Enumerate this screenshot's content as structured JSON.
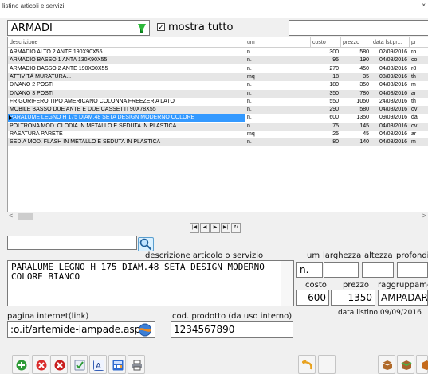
{
  "window": {
    "title": "listino articoli e servizi",
    "close_glyph": "×"
  },
  "filter": {
    "category": "ARMADI",
    "show_all_checked": true,
    "show_all_label": "mostra tutto",
    "search_value": ""
  },
  "grid": {
    "columns": [
      "descrizione",
      "um",
      "costo",
      "prezzo",
      "data lst.pr...",
      "pr"
    ],
    "rows": [
      [
        "ARMADIO ALTO 2 ANTE 190X90X55",
        "n.",
        "300",
        "580",
        "02/09/2016",
        "ro"
      ],
      [
        "ARMADIO BASSO 1 ANTA 130X90X55",
        "n.",
        "95",
        "190",
        "04/08/2016",
        "co"
      ],
      [
        "ARMADIO BASSO 2 ANTE 190X90X55",
        "n.",
        "270",
        "450",
        "04/08/2016",
        "r8"
      ],
      [
        "ATTIVITÀ MURATURA...",
        "mq",
        "18",
        "35",
        "08/09/2016",
        "th"
      ],
      [
        "DIVANO 2 POSTI",
        "n.",
        "180",
        "350",
        "04/08/2016",
        "m"
      ],
      [
        "DIVANO 3 POSTI",
        "n.",
        "350",
        "780",
        "04/08/2016",
        "ar"
      ],
      [
        "FRIGORIFERO TIPO AMERICANO COLONNA FREEZER A LATO",
        "n.",
        "550",
        "1050",
        "24/08/2016",
        "th"
      ],
      [
        "MOBILE BASSO DUE ANTE E DUE CASSETTI 90X78X55",
        "n.",
        "290",
        "580",
        "04/08/2016",
        "ov"
      ],
      [
        "PARALUME LEGNO H 175 DIAM.48 SETA DESIGN MODERNO COLORE",
        "n.",
        "600",
        "1350",
        "09/09/2016",
        "da"
      ],
      [
        "POLTRONA MOD. CLODIA IN METALLO E SEDUTA IN PLASTICA",
        "n.",
        "75",
        "145",
        "04/08/2016",
        "ov"
      ],
      [
        "RASATURA PARETE",
        "mq",
        "25",
        "45",
        "04/08/2016",
        "ar"
      ],
      [
        "SEDIA MOD. FLASH IN METALLO E SEDUTA IN PLASTICA",
        "n.",
        "80",
        "140",
        "04/08/2016",
        "m"
      ]
    ],
    "selected_index": 8
  },
  "navigator": [
    "|◀",
    "◀",
    "▶",
    "▶|",
    "↻"
  ],
  "scroll": {
    "left_glyph": "<",
    "right_glyph": ">"
  },
  "detail": {
    "desc_label": "descrizione articolo o servizio",
    "desc_value": "PARALUME LEGNO H 175 DIAM.48 SETA DESIGN MODERNO COLORE BIANCO",
    "um_label": "um",
    "larghezza_label": "larghezza",
    "altezza_label": "altezza",
    "profondita_label": "profondi",
    "um_value": "n.",
    "larghezza_value": "",
    "altezza_value": "",
    "profondita_value": "",
    "costo_label": "costo",
    "prezzo_label": "prezzo",
    "raggruppamento_label": "raggruppamen",
    "costo_value": "600",
    "prezzo_value": "1350",
    "raggruppamento_value": "AMPADARI",
    "data_listino": "data listino 09/09/2016",
    "web_label": "pagina internet(link)",
    "web_value": ":o.it/artemide-lampade.asp",
    "code_label": "cod. prodotto (da uso interno)",
    "code_value": "1234567890"
  },
  "icons": {
    "binoculars": "binoculars-icon",
    "search": "magnifier-icon",
    "web": "web-browser-icon"
  },
  "colors": {
    "selection": "#3399ff",
    "row_alt": "#e6e6e6",
    "combo_arrow": "#2db83a"
  }
}
